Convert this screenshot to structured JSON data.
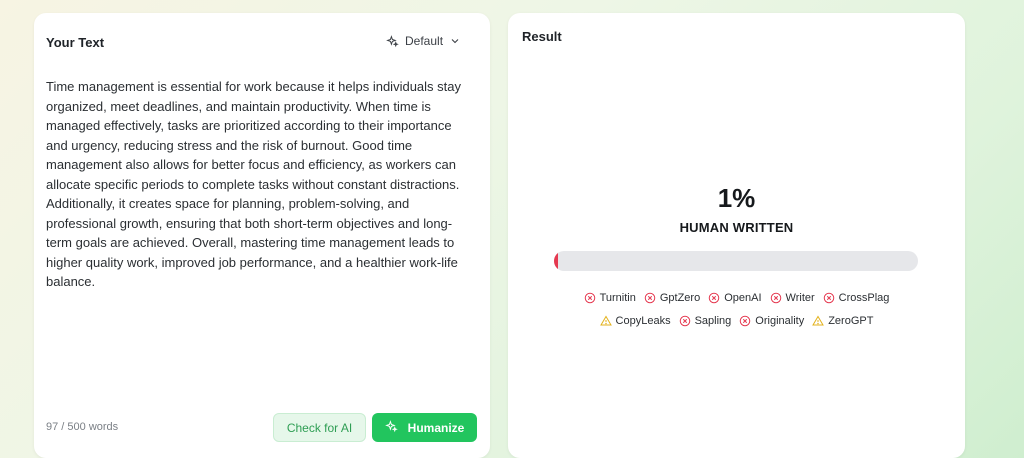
{
  "left_panel": {
    "title": "Your Text",
    "mode": "Default",
    "text": "Time management is essential for work because it helps individuals stay organized, meet deadlines, and maintain productivity. When time is managed effectively, tasks are prioritized according to their importance and urgency, reducing stress and the risk of burnout. Good time management also allows for better focus and efficiency, as workers can allocate specific periods to complete tasks without constant distractions. Additionally, it creates space for planning, problem-solving, and professional growth, ensuring that both short-term objectives and long-term goals are achieved. Overall, mastering time management leads to higher quality work, improved job performance, and a healthier work-life balance.",
    "word_count": "97 / 500 words",
    "check_ai_label": "Check for AI",
    "humanize_label": "Humanize"
  },
  "right_panel": {
    "title": "Result",
    "score": "1%",
    "score_label": "HUMAN WRITTEN",
    "progress_fraction": 0.01,
    "detectors_row1": [
      {
        "name": "Turnitin",
        "status": "fail"
      },
      {
        "name": "GptZero",
        "status": "fail"
      },
      {
        "name": "OpenAI",
        "status": "fail"
      },
      {
        "name": "Writer",
        "status": "fail"
      },
      {
        "name": "CrossPlag",
        "status": "fail"
      }
    ],
    "detectors_row2": [
      {
        "name": "CopyLeaks",
        "status": "warning"
      },
      {
        "name": "Sapling",
        "status": "fail"
      },
      {
        "name": "Originality",
        "status": "fail"
      },
      {
        "name": "ZeroGPT",
        "status": "warning"
      }
    ]
  },
  "colors": {
    "accent_green": "#22c55e",
    "fail_red": "#e53950",
    "warning_yellow": "#e3b21c"
  }
}
